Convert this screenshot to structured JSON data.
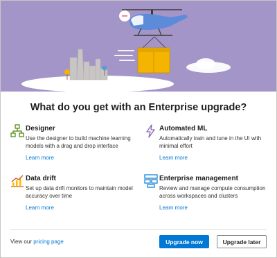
{
  "hero": {
    "illustration": "helicopter-carrying-box"
  },
  "dialog": {
    "title": "What do you get with an Enterprise upgrade?"
  },
  "features": [
    {
      "icon": "designer-icon",
      "title": "Designer",
      "desc": "Use the designer to build machine learning models with a drag and drop interface",
      "link": "Learn more"
    },
    {
      "icon": "automated-ml-icon",
      "title": "Automated ML",
      "desc": "Automatically train and tune in the UI with minimal effort",
      "link": "Learn more"
    },
    {
      "icon": "data-drift-icon",
      "title": "Data drift",
      "desc": "Set up data drift monitors to maintain model accuracy over time",
      "link": "Learn more"
    },
    {
      "icon": "enterprise-management-icon",
      "title": "Enterprise management",
      "desc": "Review and manage compute consumption across workspaces and clusters",
      "link": "Learn more"
    }
  ],
  "footer": {
    "prefix": "View our",
    "pricing_link": "pricing page",
    "upgrade_label": "Upgrade now",
    "later_label": "Upgrade later"
  },
  "colors": {
    "hero_bg": "#a495c8",
    "accent": "#0078d4"
  }
}
